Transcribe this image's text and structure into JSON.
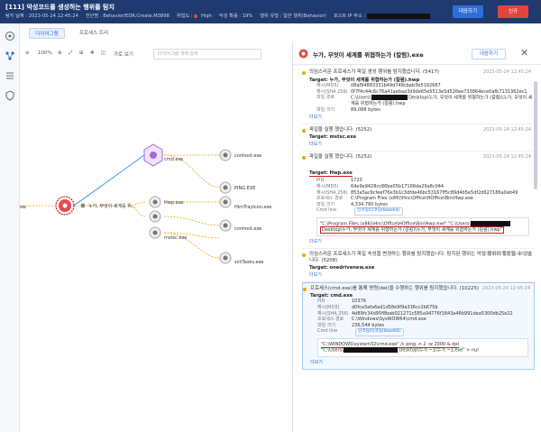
{
  "header": {
    "title": "[111] 악성코드를 생성하는 행위를 탐지",
    "detect_time": "탐지 날짜 : 2023-05-24 12:45:24",
    "detector": "진단명 : Behavior/EDR.Create.M3898",
    "risk_label": "위험도 :",
    "risk_value": "High",
    "progress": "악성 확률 : 19%",
    "behavior_type": "행위 유형 : 일반 행위(Behavior)",
    "host_ip": "호스트 IP 주소 :",
    "respond_button": "대응하기",
    "new_button": "신규"
  },
  "tabs": {
    "diagram": "다이어그램",
    "process_tree": "프로세스 트리"
  },
  "graph_toolbar": {
    "zoom": "100%",
    "view": "가로 보기",
    "search_placeholder": "다이어그램 개체 검색"
  },
  "graph": {
    "n_exe": "exe",
    "n_main": "누가, 무엇이 세계를 위...",
    "n_cmd": "cmd.exe",
    "n_conhost1": "conhost.exe",
    "n_ping": "PING.EXE",
    "n_hwp": "Hwp.exe",
    "n_conhost2": "HimTrayIcon.exe",
    "n_mstsc": "mstsc.exe",
    "n_conhost3": "conhost.exe",
    "n_schtasks": "schTasks.exe"
  },
  "panel": {
    "title": "누가, 무엇이 세계를 위협하는가 (칼럼).exe",
    "respond_button": "대응하기"
  },
  "cards": [
    {
      "title": "의심스러운 프로세스가 파일 생성 행위를 탐지했습니다. (5417)",
      "time": "2023-05-24 12:45:24",
      "target": "Target: 누가, 무엇이 세계를 위협하는가 (칼럼).hwp",
      "k1": "해시(MD5)",
      "v1": "08af94883331b49d748cbab3b5192687",
      "k2": "해시(SHA 256)",
      "v2": "0f7f4c44c6c76a41aebaa3d9de65e5513e5d526ee733864ece0afb7131362ec1",
      "k3": "파일 경로",
      "v3a": "C:\\Users\\",
      "v3b": "Desktop\\누가, 무엇이 세계를 위협하는가 (칼럼)\\누가, 무엇이 세계를 위협하는가 (칼럼).hwp",
      "k4": "파일 크기",
      "v4": "89,088 bytes",
      "more": "더보기"
    },
    {
      "title": "파일을 실행 했습니다. (5252)",
      "time": "2023-05-24 12:45:24",
      "target": "Target: mstsc.exe",
      "more": "더보기"
    },
    {
      "title": "파일을 실행 했습니다. (5252)",
      "time": "2023-05-24 12:45:24",
      "target": "Target: Hwp.exe",
      "k0": "PID",
      "v0": "1720",
      "k1": "해시(MD5)",
      "v1": "64e9e9428cc86be05b17168da29a8c044",
      "k2": "해시(SHA 256)",
      "v2": "853a5ac6cfeef76e3b1c3dfde46bc53167ff5c89d4b5e5df2d627186a0ab49",
      "k3": "프로세스 경로",
      "v3": "C:\\Program Files (x86)\\Hnc\\Office\\HOffice\\Bin\\Hwp.exe",
      "k4": "파일 크기",
      "v4": "4,334,760 bytes",
      "k5": "Cmd line",
      "tag": "인코딩/디코딩(Base64)",
      "cmd": "\"C:\\Program Files (x86)\\Hnc\\Office\\HOffice\\Bin\\Hwp.exe\" \"C:\\Users\\",
      "cmd2": "Desktop\\누가, 무엇이 세계를 위협하는가 (칼럼)\\누가, 무엇이 세계를 위협하는가 (칼럼).hwp\"",
      "more": "더보기"
    },
    {
      "title": "의심스러운 프로세스가 파일 속성을 변경하는 행위를 탐지했습니다. 탐지된 행위는 악성 행위의 활동될 수 있습니다. (5208)",
      "time": "2023-05-24 12:45:24",
      "target": "Target: onedrivenew.exe",
      "more": "더보기"
    },
    {
      "title": "프로세스(cmd.exe)를 통해 명령(del)을 수행하는 행위를 탐지했습니다. (10225)",
      "time": "2023-05-24 12:45:24",
      "target": "Target: cmd.exe",
      "k0": "PID",
      "v0": "10376",
      "k1": "해시(MD5)",
      "v1": "d0fca3afa6ad1d58e9f9a336cc2b675b",
      "k2": "해시(SHA 256)",
      "v2": "4d89fc34d95f8bab021271c585a94776f1843a46b991dea5300db25e22",
      "k3": "프로세스 경로",
      "v3": "C:\\Windows\\SysWOW64\\cmd.exe",
      "k4": "파일 크기",
      "v4": "236,544 bytes",
      "k5": "Cmd line",
      "tag": "인코딩/디코딩(Base64)",
      "cmd": "\"C:\\WINDOWS\\system32\\cmd.exe\" /c ping -n 2 -w 2000 & del",
      "cmd2": "\"C:\\Users\\",
      "cmd3": "Desktop\\누가.~1\\누가.~1.exe\" > nul",
      "more": "더보기"
    }
  ]
}
